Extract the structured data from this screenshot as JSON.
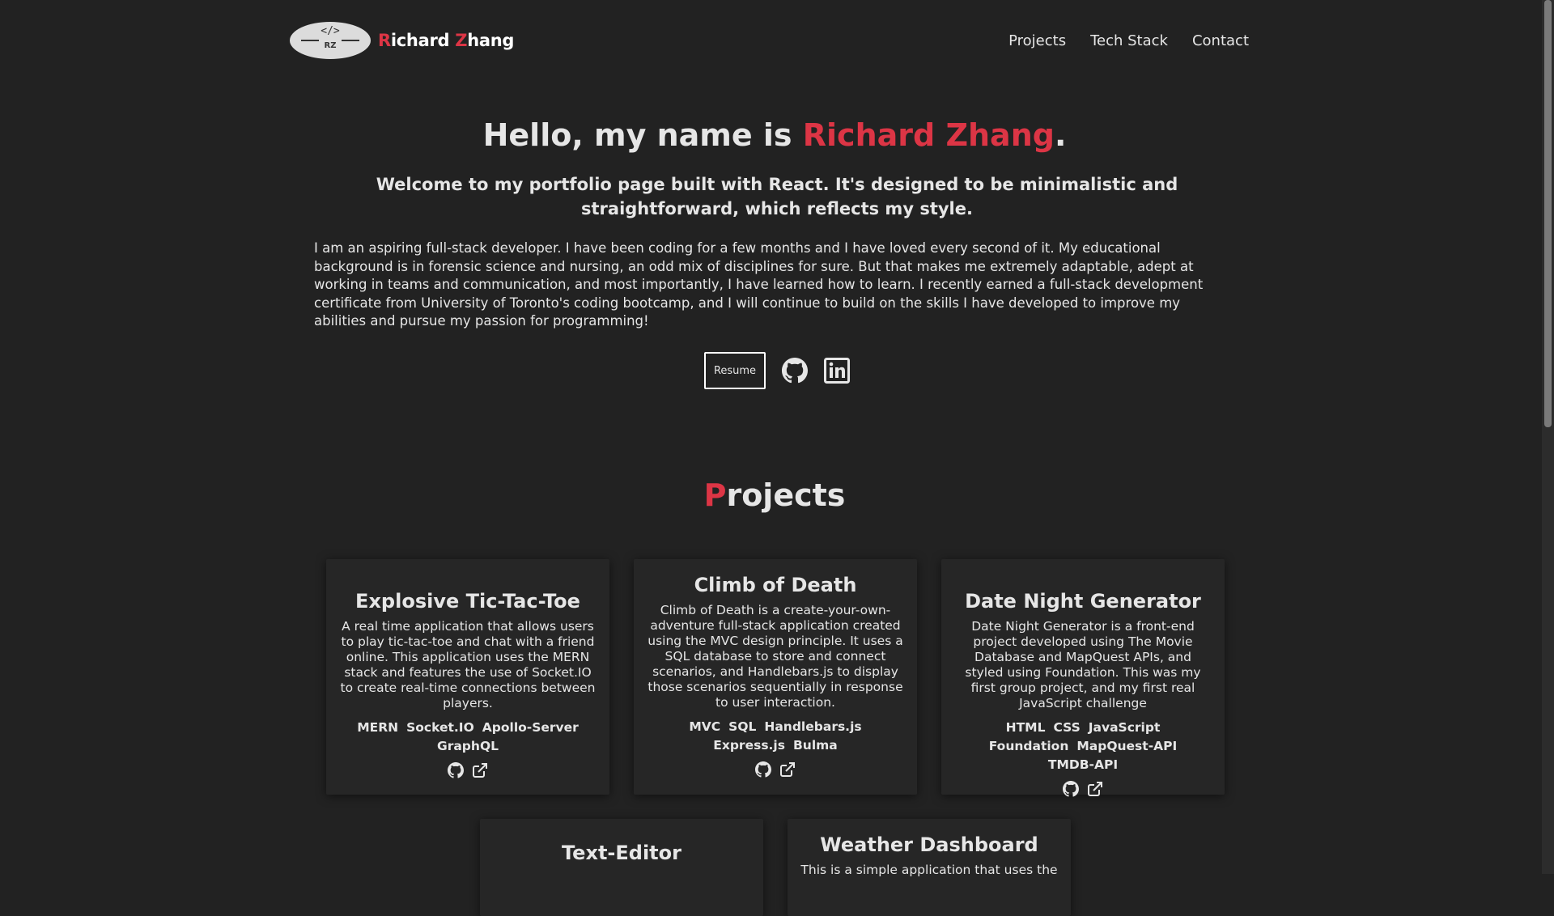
{
  "nav": {
    "logo_code": "</>",
    "logo_initials": "RZ",
    "brand_first_initial": "R",
    "brand_first_rest": "ichard ",
    "brand_last_initial": "Z",
    "brand_last_rest": "hang",
    "links": [
      {
        "label": "Projects"
      },
      {
        "label": "Tech Stack"
      },
      {
        "label": "Contact"
      }
    ]
  },
  "hero": {
    "greeting": "Hello, my name is ",
    "name": "Richard Zhang",
    "period": ".",
    "subtitle": "Welcome to my portfolio page built with React. It's designed to be minimalistic and straightforward, which reflects my style.",
    "bio": "I am an aspiring full-stack developer. I have been coding for a few months and I have loved every second of it. My educational background is in forensic science and nursing, an odd mix of disciplines for sure. But that makes me extremely adaptable, adept at working in teams and communication, and most importantly, I have learned how to learn. I recently earned a full-stack development certificate from University of Toronto's coding bootcamp, and I will continue to build on the skills I have developed to improve my abilities and pursue my passion for programming!",
    "resume_label": "Resume",
    "icons": [
      "github-icon",
      "linkedin-icon"
    ]
  },
  "projects": {
    "title_initial": "P",
    "title_rest": "rojects",
    "cards": [
      {
        "title": "Explosive Tic-Tac-Toe",
        "description": "A real time application that allows users to play tic-tac-toe and chat with a friend online. This application uses the MERN stack and features the use of Socket.IO to create real-time connections between players.",
        "tags": [
          "MERN",
          "Socket.IO",
          "Apollo-Server",
          "GraphQL"
        ]
      },
      {
        "title": "Climb of Death",
        "description": "Climb of Death is a create-your-own-adventure full-stack application created using the MVC design principle. It uses a SQL database to store and connect scenarios, and Handlebars.js to display those scenarios sequentially in response to user interaction.",
        "tags": [
          "MVC",
          "SQL",
          "Handlebars.js",
          "Express.js",
          "Bulma"
        ]
      },
      {
        "title": "Date Night Generator",
        "description": "Date Night Generator is a front-end project developed using The Movie Database and MapQuest APIs, and styled using Foundation. This was my first group project, and my first real JavaScript challenge",
        "tags": [
          "HTML",
          "CSS",
          "JavaScript",
          "Foundation",
          "MapQuest-API",
          "TMDB-API"
        ]
      },
      {
        "title": "Text-Editor",
        "description": "",
        "tags": []
      },
      {
        "title": "Weather Dashboard",
        "description": "This is a simple application that uses the",
        "tags": []
      }
    ]
  },
  "colors": {
    "background": "#222222",
    "accent": "#dc3545",
    "text": "#e6e6e6",
    "card": "#262626"
  }
}
